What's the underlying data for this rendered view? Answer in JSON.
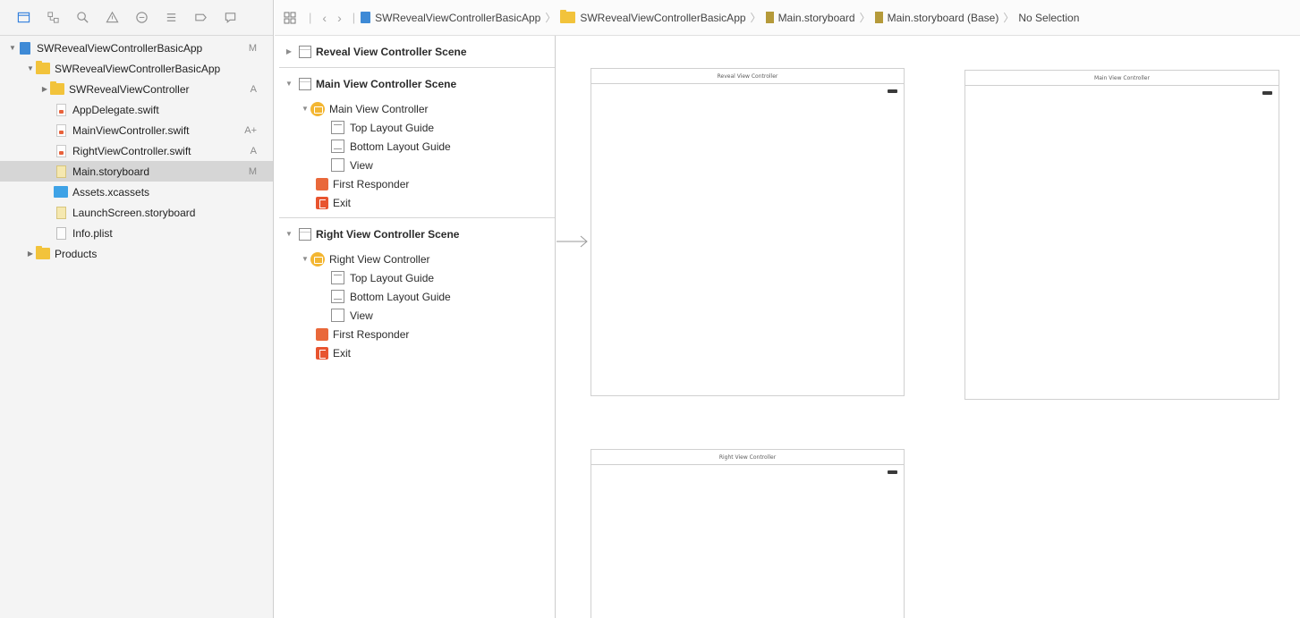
{
  "navigator": {
    "toolbar_icons": [
      "project-navigator-icon",
      "source-control-icon",
      "find-navigator-icon",
      "issue-navigator-icon",
      "test-navigator-icon",
      "debug-navigator-icon",
      "breakpoint-navigator-icon",
      "report-navigator-icon"
    ],
    "items": [
      {
        "label": "SWRevealViewControllerBasicApp",
        "status": "M",
        "icon": "project-icon"
      },
      {
        "label": "SWRevealViewControllerBasicApp",
        "status": "",
        "icon": "folder-icon"
      },
      {
        "label": "SWRevealViewController",
        "status": "A",
        "icon": "folder-icon"
      },
      {
        "label": "AppDelegate.swift",
        "status": "",
        "icon": "swift-file-icon"
      },
      {
        "label": "MainViewController.swift",
        "status": "A+",
        "icon": "swift-file-icon"
      },
      {
        "label": "RightViewController.swift",
        "status": "A",
        "icon": "swift-file-icon"
      },
      {
        "label": "Main.storyboard",
        "status": "M",
        "icon": "storyboard-file-icon"
      },
      {
        "label": "Assets.xcassets",
        "status": "",
        "icon": "asset-catalog-icon"
      },
      {
        "label": "LaunchScreen.storyboard",
        "status": "",
        "icon": "storyboard-file-icon"
      },
      {
        "label": "Info.plist",
        "status": "",
        "icon": "plist-file-icon"
      },
      {
        "label": "Products",
        "status": "",
        "icon": "folder-icon"
      }
    ]
  },
  "jumpbar": {
    "crumbs": [
      "SWRevealViewControllerBasicApp",
      "SWRevealViewControllerBasicApp",
      "Main.storyboard",
      "Main.storyboard (Base)",
      "No Selection"
    ]
  },
  "outline": {
    "scenes": [
      {
        "title": "Reveal View Controller Scene",
        "expanded": false
      },
      {
        "title": "Main View Controller Scene",
        "expanded": true,
        "controller": "Main View Controller",
        "children": [
          "Top Layout Guide",
          "Bottom Layout Guide",
          "View"
        ],
        "first_responder": "First Responder",
        "exit": "Exit"
      },
      {
        "title": "Right View Controller Scene",
        "expanded": true,
        "controller": "Right View Controller",
        "children": [
          "Top Layout Guide",
          "Bottom Layout Guide",
          "View"
        ],
        "first_responder": "First Responder",
        "exit": "Exit"
      }
    ]
  },
  "canvas": {
    "frames": [
      {
        "title": "Reveal View Controller"
      },
      {
        "title": "Main View Controller"
      },
      {
        "title": "Right View Controller"
      }
    ]
  },
  "colors": {
    "accent": "#2f7ddc",
    "folder": "#f2c33b",
    "view_controller": "#f3b632",
    "first_responder": "#e9683a",
    "exit": "#e8542f",
    "selection": "#d6d6d6"
  }
}
